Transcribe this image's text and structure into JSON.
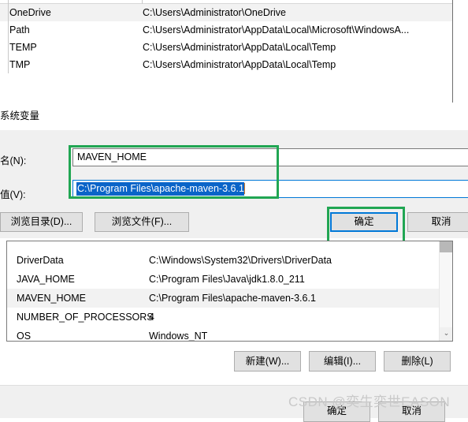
{
  "user_variables_list": {
    "rows": [
      {
        "name": "OneDrive",
        "value": "C:\\Users\\Administrator\\OneDrive"
      },
      {
        "name": "Path",
        "value": "C:\\Users\\Administrator\\AppData\\Local\\Microsoft\\WindowsA..."
      },
      {
        "name": "TEMP",
        "value": "C:\\Users\\Administrator\\AppData\\Local\\Temp"
      },
      {
        "name": "TMP",
        "value": "C:\\Users\\Administrator\\AppData\\Local\\Temp"
      }
    ]
  },
  "section": {
    "system_variables_caption": "系统变量"
  },
  "edit_dialog": {
    "name_label": "名(N):",
    "name_value": "MAVEN_HOME",
    "value_label": "值(V):",
    "value_selected_text": "C:\\Program Files\\apache-maven-3.6.1",
    "browse_directory_button": "浏览目录(D)...",
    "browse_file_button": "浏览文件(F)...",
    "ok_button": "确定",
    "cancel_button": "取消"
  },
  "system_variables_list": {
    "rows": [
      {
        "name": "DriverData",
        "value": "C:\\Windows\\System32\\Drivers\\DriverData"
      },
      {
        "name": "JAVA_HOME",
        "value": "C:\\Program Files\\Java\\jdk1.8.0_211"
      },
      {
        "name": "MAVEN_HOME",
        "value": "C:\\Program Files\\apache-maven-3.6.1"
      },
      {
        "name": "NUMBER_OF_PROCESSORS",
        "value": "4"
      },
      {
        "name": "OS",
        "value": "Windows_NT"
      }
    ],
    "scroll_down_glyph": "⌄"
  },
  "list_actions": {
    "new_button": "新建(W)...",
    "edit_button": "编辑(I)...",
    "delete_button": "删除(L)"
  },
  "window_footer": {
    "ok_button": "确定",
    "cancel_button": "取消"
  },
  "watermark": {
    "text": "CSDN @奕生奕世EASON"
  },
  "colors": {
    "annotation_green": "#21a653",
    "focus_blue": "#0078d7",
    "selection_blue": "#0a64c8",
    "alt_row": "#f2f2f2",
    "dialog_bg": "#f0f0f0"
  }
}
